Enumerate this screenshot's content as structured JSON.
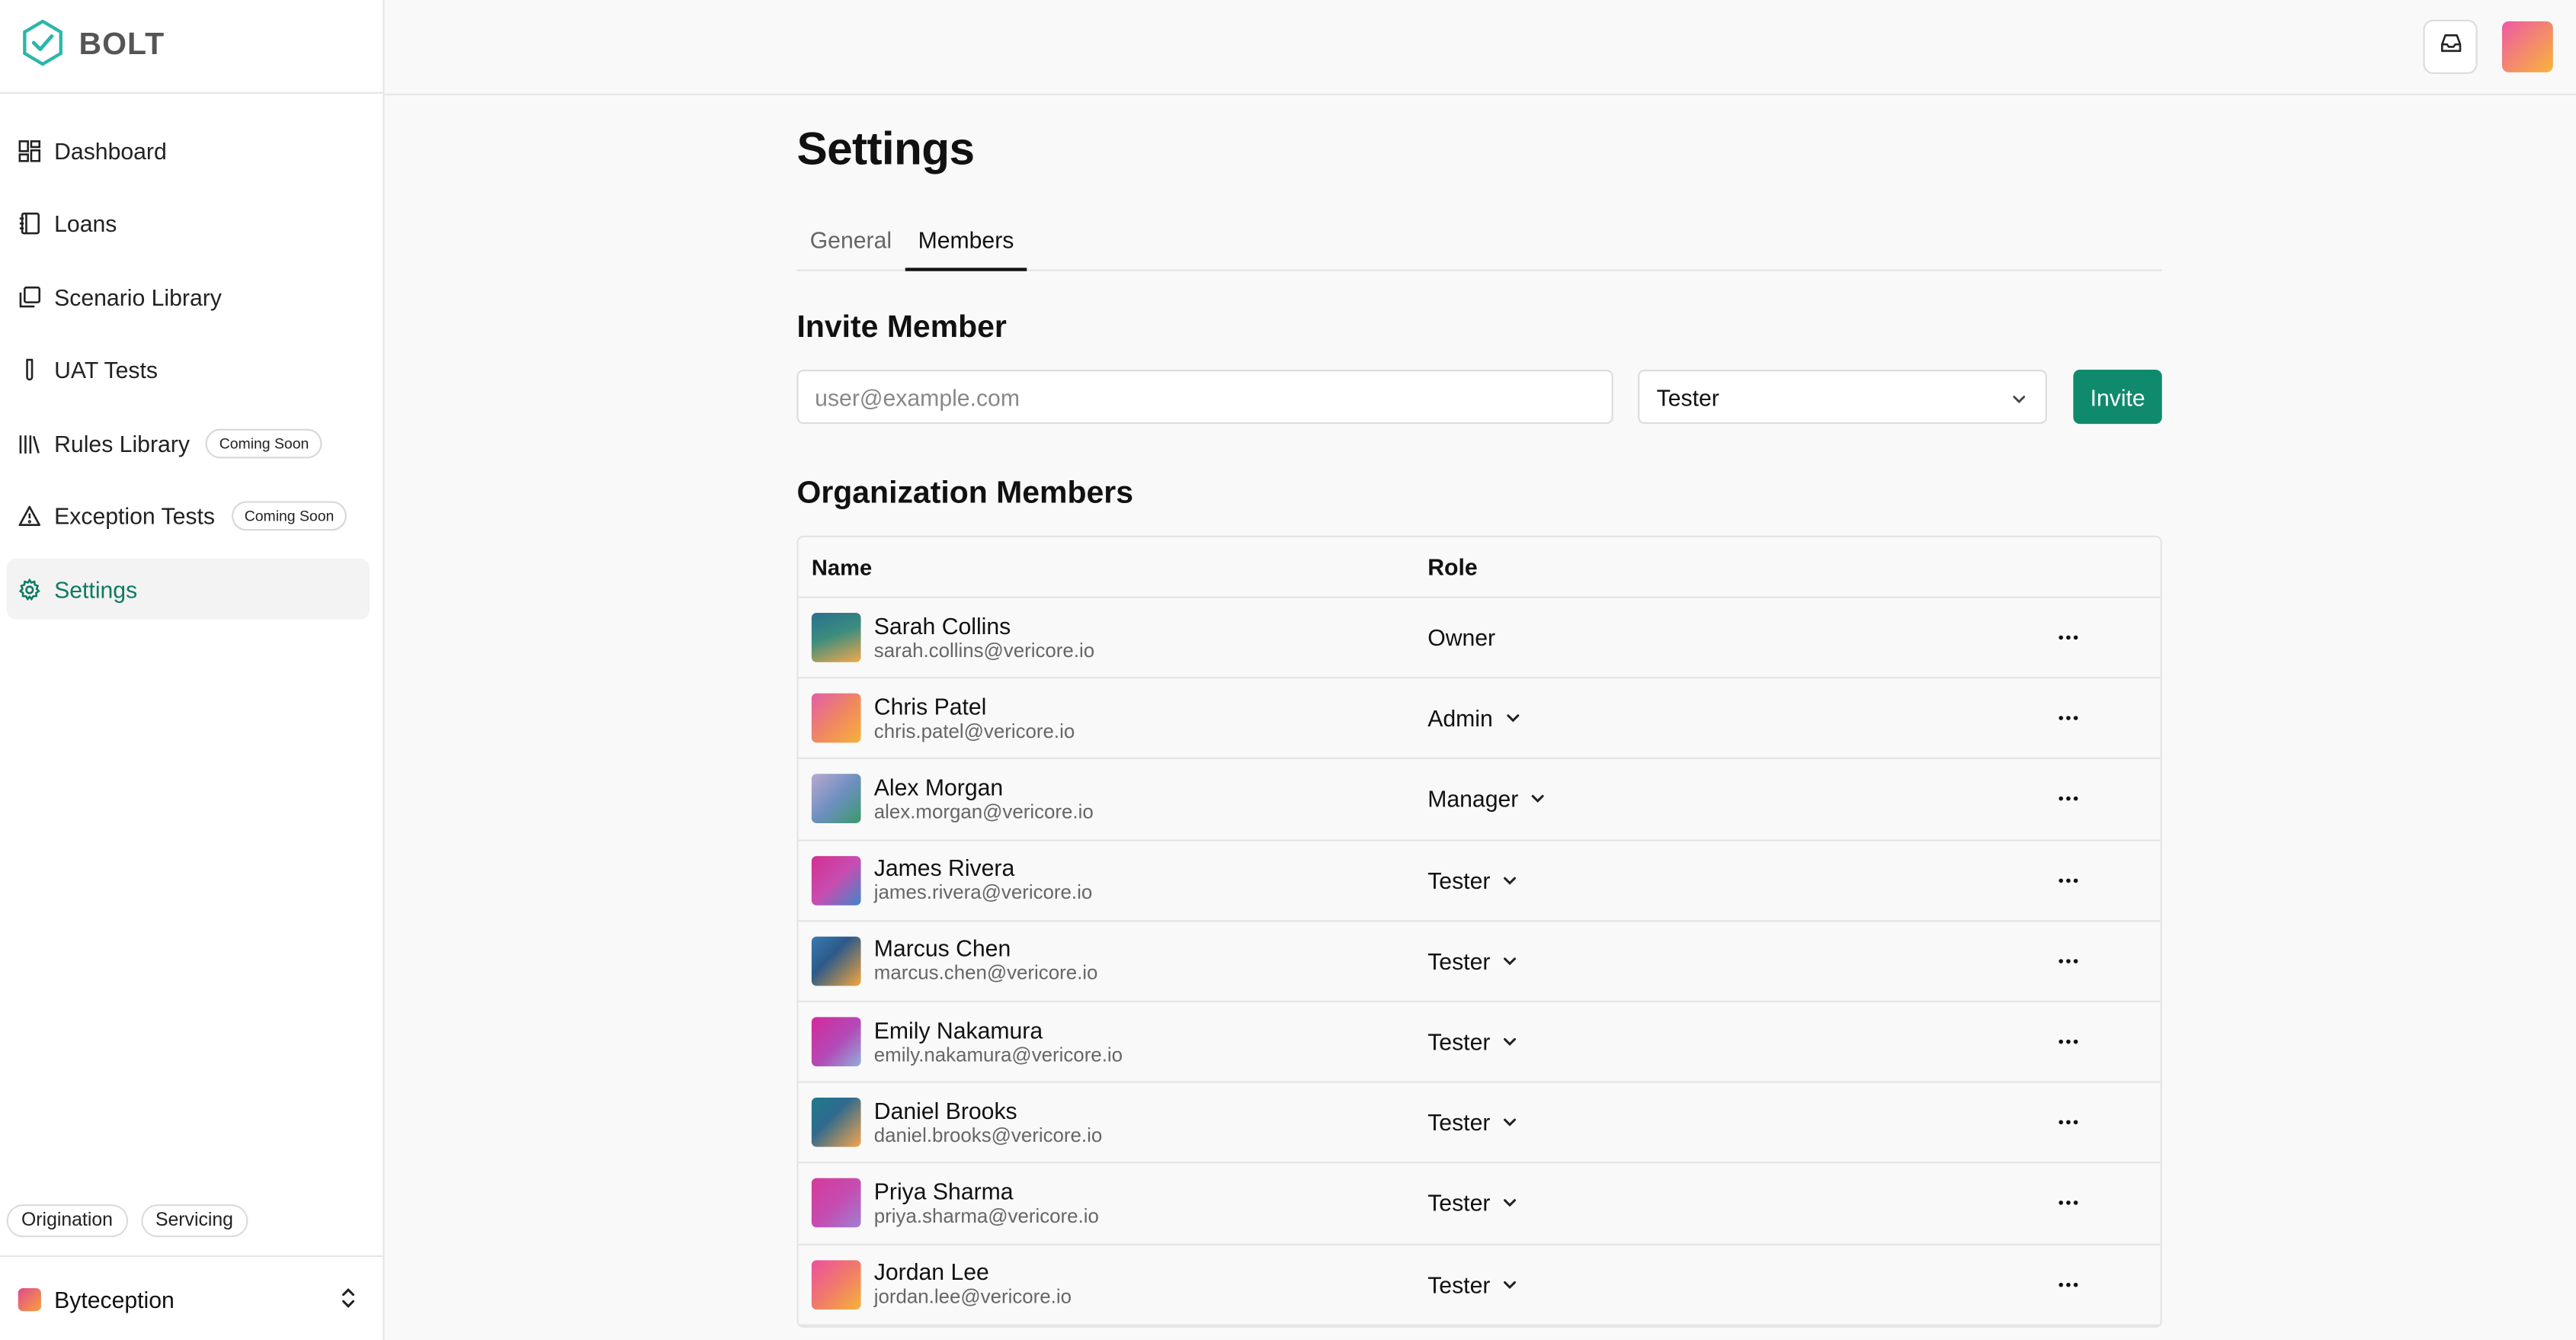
{
  "brand": {
    "name": "BOLT",
    "accent": "#0f8a6c"
  },
  "sidebar": {
    "items": [
      {
        "label": "Dashboard",
        "icon": "dashboard-icon"
      },
      {
        "label": "Loans",
        "icon": "notebook-icon"
      },
      {
        "label": "Scenario Library",
        "icon": "library-copy-icon"
      },
      {
        "label": "UAT Tests",
        "icon": "test-tube-icon"
      },
      {
        "label": "Rules Library",
        "icon": "books-icon",
        "badge": "Coming Soon"
      },
      {
        "label": "Exception Tests",
        "icon": "warning-triangle-icon",
        "badge": "Coming Soon"
      },
      {
        "label": "Settings",
        "icon": "gear-icon",
        "active": true
      }
    ],
    "pills": [
      "Origination",
      "Servicing"
    ],
    "org_name": "Byteception"
  },
  "page": {
    "title": "Settings",
    "tabs": [
      {
        "label": "General"
      },
      {
        "label": "Members",
        "active": true
      }
    ]
  },
  "invite": {
    "heading": "Invite Member",
    "email_placeholder": "user@example.com",
    "role_value": "Tester",
    "button_label": "Invite"
  },
  "members": {
    "heading": "Organization Members",
    "columns": [
      "Name",
      "Role"
    ],
    "rows": [
      {
        "name": "Sarah Collins",
        "email": "sarah.collins@vericore.io",
        "role": "Owner",
        "editable": false
      },
      {
        "name": "Chris Patel",
        "email": "chris.patel@vericore.io",
        "role": "Admin",
        "editable": true
      },
      {
        "name": "Alex Morgan",
        "email": "alex.morgan@vericore.io",
        "role": "Manager",
        "editable": true
      },
      {
        "name": "James Rivera",
        "email": "james.rivera@vericore.io",
        "role": "Tester",
        "editable": true
      },
      {
        "name": "Marcus Chen",
        "email": "marcus.chen@vericore.io",
        "role": "Tester",
        "editable": true
      },
      {
        "name": "Emily Nakamura",
        "email": "emily.nakamura@vericore.io",
        "role": "Tester",
        "editable": true
      },
      {
        "name": "Daniel Brooks",
        "email": "daniel.brooks@vericore.io",
        "role": "Tester",
        "editable": true
      },
      {
        "name": "Priya Sharma",
        "email": "priya.sharma@vericore.io",
        "role": "Tester",
        "editable": true
      },
      {
        "name": "Jordan Lee",
        "email": "jordan.lee@vericore.io",
        "role": "Tester",
        "editable": true
      }
    ]
  }
}
